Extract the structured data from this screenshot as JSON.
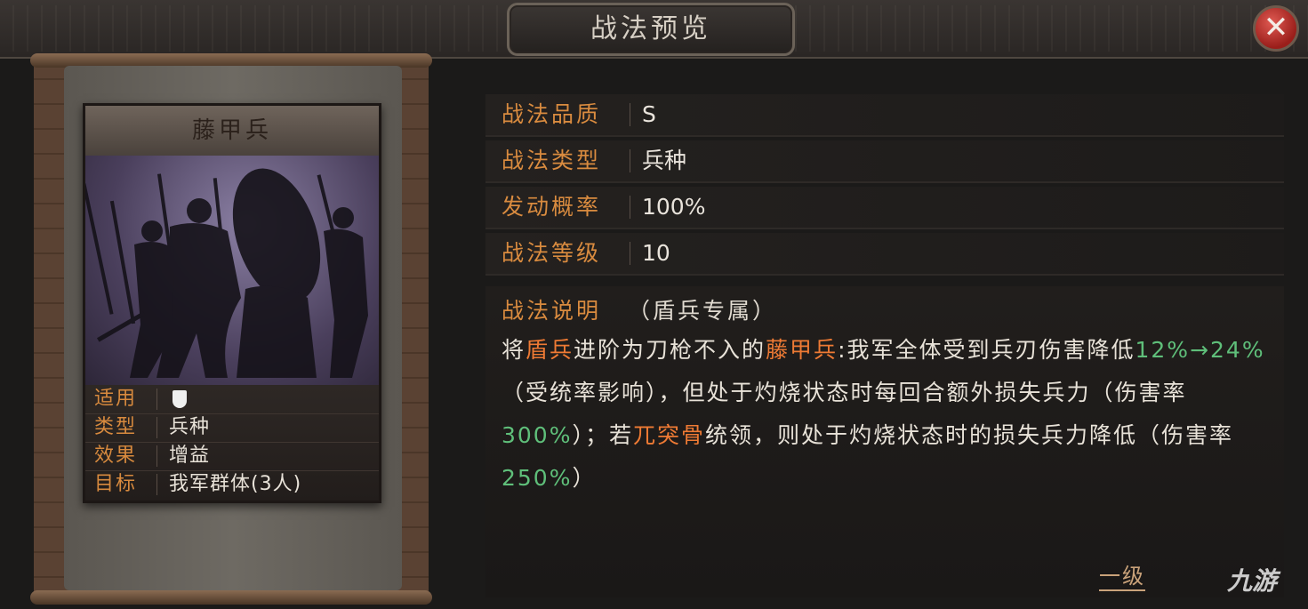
{
  "window": {
    "title": "战法预览"
  },
  "card": {
    "name": "藤甲兵",
    "info": [
      {
        "label": "适用",
        "value": "",
        "icon": "shield-icon"
      },
      {
        "label": "类型",
        "value": "兵种"
      },
      {
        "label": "效果",
        "value": "增益"
      },
      {
        "label": "目标",
        "value": "我军群体(3人)"
      }
    ]
  },
  "attributes": [
    {
      "label": "战法品质",
      "value": "S"
    },
    {
      "label": "战法类型",
      "value": "兵种"
    },
    {
      "label": "发动概率",
      "value": "100%"
    },
    {
      "label": "战法等级",
      "value": "10"
    }
  ],
  "description": {
    "label": "战法说明",
    "note": "（盾兵专属）",
    "parts": [
      {
        "text": "将",
        "style": "normal"
      },
      {
        "text": "盾兵",
        "style": "orange"
      },
      {
        "text": "进阶为刀枪不入的",
        "style": "normal"
      },
      {
        "text": "藤甲兵",
        "style": "orange"
      },
      {
        "text": ":我军全体受到兵刃伤害降低",
        "style": "normal"
      },
      {
        "text": "12%→24%",
        "style": "green"
      },
      {
        "text": "（受统率影响），但处于灼烧状态时每回合额外损失兵力（伤害率",
        "style": "normal"
      },
      {
        "text": "300%",
        "style": "green"
      },
      {
        "text": "）；若",
        "style": "normal"
      },
      {
        "text": "兀突骨",
        "style": "orange"
      },
      {
        "text": "统领，则处于灼烧状态时的损失兵力降低（伤害率",
        "style": "normal"
      },
      {
        "text": "250%",
        "style": "green"
      },
      {
        "text": "）",
        "style": "normal"
      }
    ]
  },
  "footer": {
    "level_link": "一级",
    "watermark": "九游"
  },
  "colors": {
    "accent_orange": "#ee7a34",
    "highlight_green": "#5fbf7a",
    "label_orange": "#d98b3f",
    "close_red": "#c9332c"
  }
}
